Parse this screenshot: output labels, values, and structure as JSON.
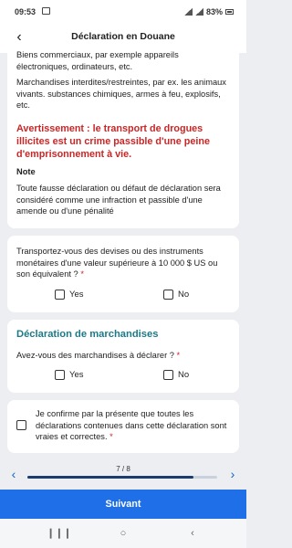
{
  "status_bar": {
    "time": "09:53",
    "battery": "83%"
  },
  "header": {
    "title": "Déclaration en Douane"
  },
  "intro": {
    "commercial_text": "Biens commerciaux, par exemple appareils électroniques, ordinateurs, etc.",
    "prohibited_text": "Marchandises interdites/restreintes, par ex. les animaux vivants. substances chimiques, armes à feu, explosifs, etc.",
    "warning": "Avertissement : le transport de drogues illicites est un crime passible d'une peine d'emprisonnement à vie.",
    "note_title": "Note",
    "note_text": "Toute fausse déclaration ou défaut de déclaration sera considéré comme une infraction et passible d'une amende ou d'une pénalité"
  },
  "currency_question": {
    "text": "Transportez-vous des devises ou des instruments monétaires d'une valeur supérieure à 10 000 $ US ou son équivalent ?",
    "required_mark": "*",
    "yes_label": "Yes",
    "no_label": "No"
  },
  "goods_section": {
    "title": "Déclaration de marchandises",
    "question": "Avez-vous des marchandises à déclarer ?",
    "required_mark": "*",
    "yes_label": "Yes",
    "no_label": "No"
  },
  "confirmation": {
    "text": "Je confirme par la présente que toutes les déclarations contenues dans cette déclaration sont vraies et correctes.",
    "required_mark": "*"
  },
  "pager": {
    "count_label": "7 / 8",
    "current": 7,
    "total": 8
  },
  "submit_label": "Suivant",
  "colors": {
    "accent": "#1e6fe8",
    "warning": "#c62828",
    "section_title": "#1a7a89"
  }
}
